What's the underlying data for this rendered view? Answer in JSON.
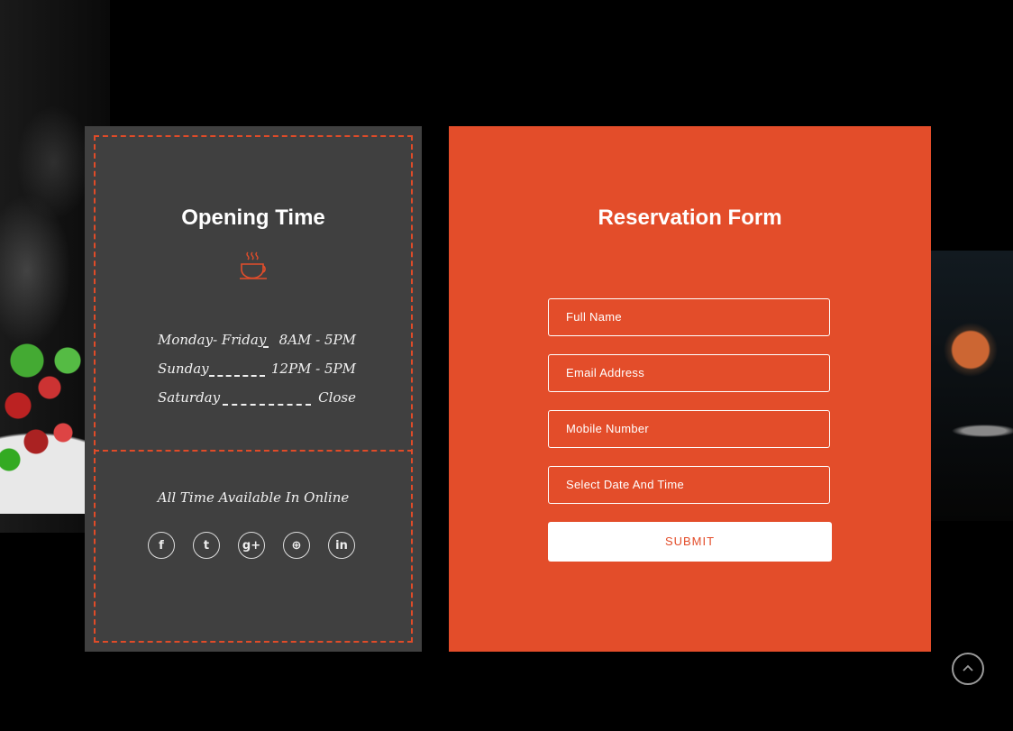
{
  "opening": {
    "title": "Opening Time",
    "icon": "coffee-cup-icon",
    "hours": [
      {
        "day": "Monday- Friday",
        "time": "8AM - 5PM"
      },
      {
        "day": "Sunday",
        "time": "12PM - 5PM"
      },
      {
        "day": "Saturday",
        "time": "Close"
      }
    ],
    "online_text": "All Time Available In Online",
    "socials": [
      {
        "name": "facebook-icon",
        "glyph": "f"
      },
      {
        "name": "twitter-icon",
        "glyph": "t"
      },
      {
        "name": "google-plus-icon",
        "glyph": "g+"
      },
      {
        "name": "dribbble-icon",
        "glyph": "⊕"
      },
      {
        "name": "linkedin-icon",
        "glyph": "in"
      }
    ]
  },
  "reservation": {
    "title": "Reservation Form",
    "fields": {
      "full_name": "Full Name",
      "email": "Email Address",
      "mobile": "Mobile Number",
      "datetime": "Select Date And Time"
    },
    "submit_label": "SUBMIT"
  },
  "colors": {
    "accent": "#e34d2a",
    "card_dark": "#404040",
    "background": "#000000"
  }
}
